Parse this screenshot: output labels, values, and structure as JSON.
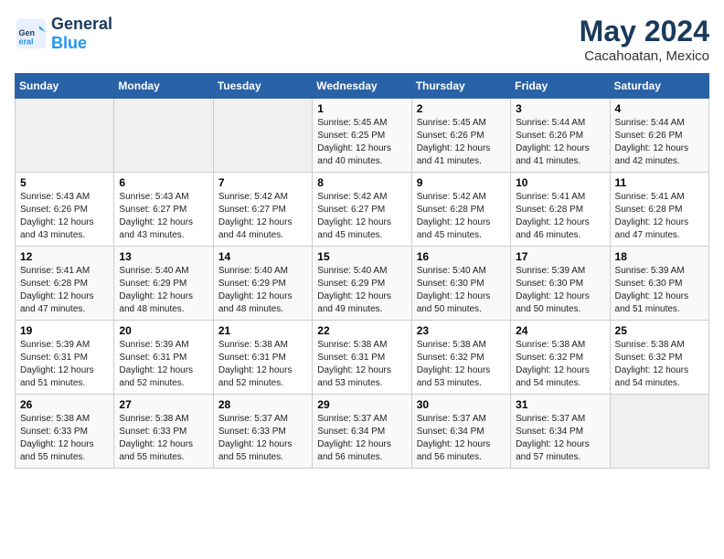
{
  "header": {
    "logo_general": "General",
    "logo_blue": "Blue",
    "title": "May 2024",
    "location": "Cacahoatan, Mexico"
  },
  "weekdays": [
    "Sunday",
    "Monday",
    "Tuesday",
    "Wednesday",
    "Thursday",
    "Friday",
    "Saturday"
  ],
  "weeks": [
    [
      {
        "day": "",
        "info": ""
      },
      {
        "day": "",
        "info": ""
      },
      {
        "day": "",
        "info": ""
      },
      {
        "day": "1",
        "info": "Sunrise: 5:45 AM\nSunset: 6:25 PM\nDaylight: 12 hours\nand 40 minutes."
      },
      {
        "day": "2",
        "info": "Sunrise: 5:45 AM\nSunset: 6:26 PM\nDaylight: 12 hours\nand 41 minutes."
      },
      {
        "day": "3",
        "info": "Sunrise: 5:44 AM\nSunset: 6:26 PM\nDaylight: 12 hours\nand 41 minutes."
      },
      {
        "day": "4",
        "info": "Sunrise: 5:44 AM\nSunset: 6:26 PM\nDaylight: 12 hours\nand 42 minutes."
      }
    ],
    [
      {
        "day": "5",
        "info": "Sunrise: 5:43 AM\nSunset: 6:26 PM\nDaylight: 12 hours\nand 43 minutes."
      },
      {
        "day": "6",
        "info": "Sunrise: 5:43 AM\nSunset: 6:27 PM\nDaylight: 12 hours\nand 43 minutes."
      },
      {
        "day": "7",
        "info": "Sunrise: 5:42 AM\nSunset: 6:27 PM\nDaylight: 12 hours\nand 44 minutes."
      },
      {
        "day": "8",
        "info": "Sunrise: 5:42 AM\nSunset: 6:27 PM\nDaylight: 12 hours\nand 45 minutes."
      },
      {
        "day": "9",
        "info": "Sunrise: 5:42 AM\nSunset: 6:28 PM\nDaylight: 12 hours\nand 45 minutes."
      },
      {
        "day": "10",
        "info": "Sunrise: 5:41 AM\nSunset: 6:28 PM\nDaylight: 12 hours\nand 46 minutes."
      },
      {
        "day": "11",
        "info": "Sunrise: 5:41 AM\nSunset: 6:28 PM\nDaylight: 12 hours\nand 47 minutes."
      }
    ],
    [
      {
        "day": "12",
        "info": "Sunrise: 5:41 AM\nSunset: 6:28 PM\nDaylight: 12 hours\nand 47 minutes."
      },
      {
        "day": "13",
        "info": "Sunrise: 5:40 AM\nSunset: 6:29 PM\nDaylight: 12 hours\nand 48 minutes."
      },
      {
        "day": "14",
        "info": "Sunrise: 5:40 AM\nSunset: 6:29 PM\nDaylight: 12 hours\nand 48 minutes."
      },
      {
        "day": "15",
        "info": "Sunrise: 5:40 AM\nSunset: 6:29 PM\nDaylight: 12 hours\nand 49 minutes."
      },
      {
        "day": "16",
        "info": "Sunrise: 5:40 AM\nSunset: 6:30 PM\nDaylight: 12 hours\nand 50 minutes."
      },
      {
        "day": "17",
        "info": "Sunrise: 5:39 AM\nSunset: 6:30 PM\nDaylight: 12 hours\nand 50 minutes."
      },
      {
        "day": "18",
        "info": "Sunrise: 5:39 AM\nSunset: 6:30 PM\nDaylight: 12 hours\nand 51 minutes."
      }
    ],
    [
      {
        "day": "19",
        "info": "Sunrise: 5:39 AM\nSunset: 6:31 PM\nDaylight: 12 hours\nand 51 minutes."
      },
      {
        "day": "20",
        "info": "Sunrise: 5:39 AM\nSunset: 6:31 PM\nDaylight: 12 hours\nand 52 minutes."
      },
      {
        "day": "21",
        "info": "Sunrise: 5:38 AM\nSunset: 6:31 PM\nDaylight: 12 hours\nand 52 minutes."
      },
      {
        "day": "22",
        "info": "Sunrise: 5:38 AM\nSunset: 6:31 PM\nDaylight: 12 hours\nand 53 minutes."
      },
      {
        "day": "23",
        "info": "Sunrise: 5:38 AM\nSunset: 6:32 PM\nDaylight: 12 hours\nand 53 minutes."
      },
      {
        "day": "24",
        "info": "Sunrise: 5:38 AM\nSunset: 6:32 PM\nDaylight: 12 hours\nand 54 minutes."
      },
      {
        "day": "25",
        "info": "Sunrise: 5:38 AM\nSunset: 6:32 PM\nDaylight: 12 hours\nand 54 minutes."
      }
    ],
    [
      {
        "day": "26",
        "info": "Sunrise: 5:38 AM\nSunset: 6:33 PM\nDaylight: 12 hours\nand 55 minutes."
      },
      {
        "day": "27",
        "info": "Sunrise: 5:38 AM\nSunset: 6:33 PM\nDaylight: 12 hours\nand 55 minutes."
      },
      {
        "day": "28",
        "info": "Sunrise: 5:37 AM\nSunset: 6:33 PM\nDaylight: 12 hours\nand 55 minutes."
      },
      {
        "day": "29",
        "info": "Sunrise: 5:37 AM\nSunset: 6:34 PM\nDaylight: 12 hours\nand 56 minutes."
      },
      {
        "day": "30",
        "info": "Sunrise: 5:37 AM\nSunset: 6:34 PM\nDaylight: 12 hours\nand 56 minutes."
      },
      {
        "day": "31",
        "info": "Sunrise: 5:37 AM\nSunset: 6:34 PM\nDaylight: 12 hours\nand 57 minutes."
      },
      {
        "day": "",
        "info": ""
      }
    ]
  ]
}
